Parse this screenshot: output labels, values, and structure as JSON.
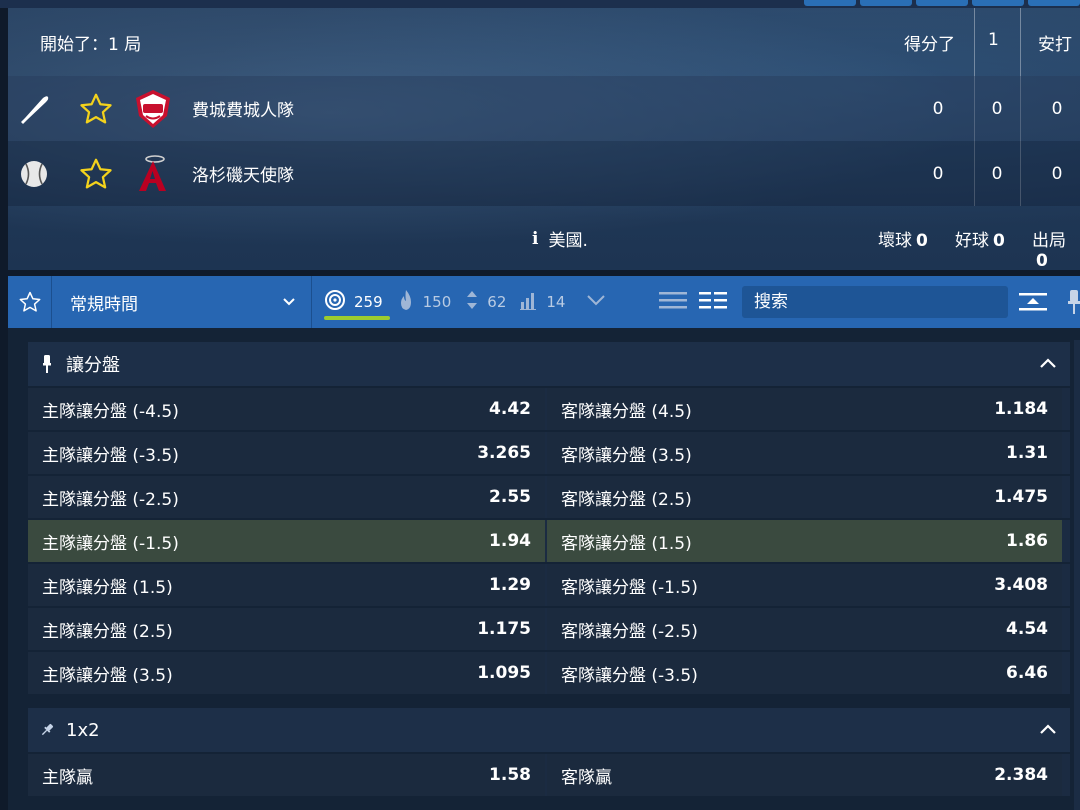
{
  "scoreboard": {
    "status": "開始了：1 局",
    "columns": [
      "得分了",
      "1",
      "安打"
    ],
    "teams": [
      {
        "name": "費城費城人隊",
        "icon": "bat-icon",
        "logo": "phillies-logo",
        "scores": [
          "0",
          "0",
          "0"
        ]
      },
      {
        "name": "洛杉磯天使隊",
        "icon": "baseball-icon",
        "logo": "angels-logo",
        "scores": [
          "0",
          "0",
          "0"
        ]
      }
    ],
    "info": "美國.",
    "counts": [
      {
        "label": "壞球",
        "value": "0"
      },
      {
        "label": "好球",
        "value": "0"
      },
      {
        "label": "出局",
        "value": "0"
      }
    ]
  },
  "toolbar": {
    "period": "常規時間",
    "counts": [
      {
        "icon": "target-icon",
        "value": "259"
      },
      {
        "icon": "fire-icon",
        "value": "150"
      },
      {
        "icon": "updown-icon",
        "value": "62"
      },
      {
        "icon": "stats-icon",
        "value": "14"
      }
    ],
    "search_placeholder": "搜索"
  },
  "markets": [
    {
      "title": "讓分盤",
      "rows": [
        {
          "home_label": "主隊讓分盤 (-4.5)",
          "home_price": "4.42",
          "away_label": "客隊讓分盤 (4.5)",
          "away_price": "1.184",
          "highlight": false
        },
        {
          "home_label": "主隊讓分盤 (-3.5)",
          "home_price": "3.265",
          "away_label": "客隊讓分盤 (3.5)",
          "away_price": "1.31",
          "highlight": false
        },
        {
          "home_label": "主隊讓分盤 (-2.5)",
          "home_price": "2.55",
          "away_label": "客隊讓分盤 (2.5)",
          "away_price": "1.475",
          "highlight": false
        },
        {
          "home_label": "主隊讓分盤 (-1.5)",
          "home_price": "1.94",
          "away_label": "客隊讓分盤 (1.5)",
          "away_price": "1.86",
          "highlight": true
        },
        {
          "home_label": "主隊讓分盤 (1.5)",
          "home_price": "1.29",
          "away_label": "客隊讓分盤 (-1.5)",
          "away_price": "3.408",
          "highlight": false
        },
        {
          "home_label": "主隊讓分盤 (2.5)",
          "home_price": "1.175",
          "away_label": "客隊讓分盤 (-2.5)",
          "away_price": "4.54",
          "highlight": false
        },
        {
          "home_label": "主隊讓分盤 (3.5)",
          "home_price": "1.095",
          "away_label": "客隊讓分盤 (-3.5)",
          "away_price": "6.46",
          "highlight": false
        }
      ]
    },
    {
      "title": "1x2",
      "rows": [
        {
          "home_label": "主隊贏",
          "home_price": "1.58",
          "away_label": "客隊贏",
          "away_price": "2.384",
          "highlight": false
        }
      ]
    }
  ],
  "colors": {
    "accent": "#2766b2",
    "active_underline": "#9ccc2f",
    "star": "#f3d21c",
    "highlight_row": "#3a4a3f"
  }
}
